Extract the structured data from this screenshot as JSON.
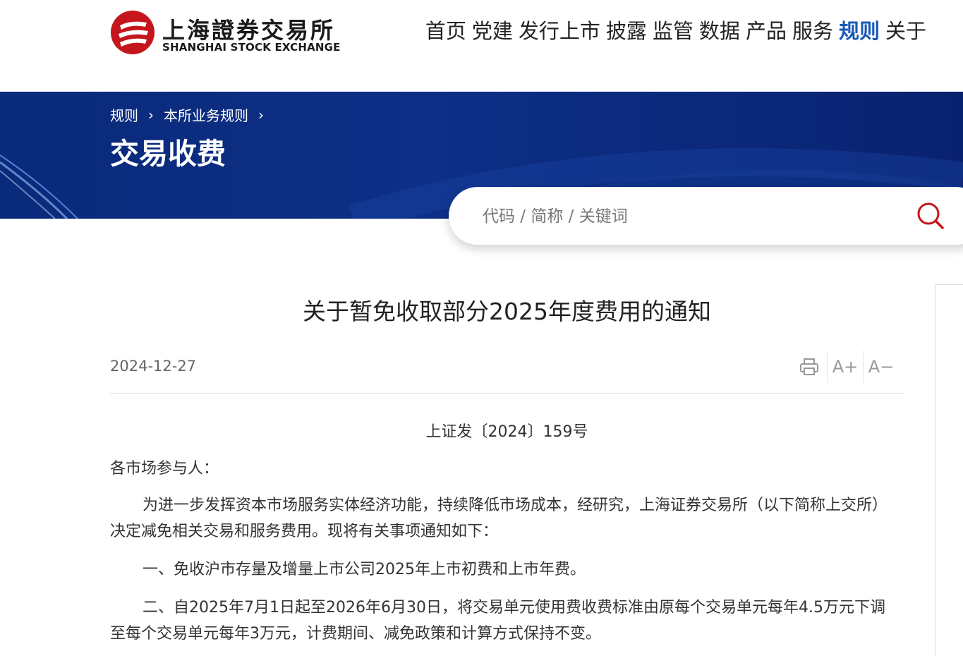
{
  "header": {
    "logo_cn": "上海證券交易所",
    "logo_en": "SHANGHAI STOCK EXCHANGE",
    "nav": [
      "首页",
      "党建",
      "发行上市",
      "披露",
      "监管",
      "数据",
      "产品",
      "服务",
      "规则",
      "关于"
    ],
    "active_nav": "规则"
  },
  "banner": {
    "breadcrumb": [
      "规则",
      "本所业务规则"
    ],
    "title": "交易收费"
  },
  "search": {
    "placeholder": "代码 / 简称 / 关键词"
  },
  "article": {
    "title": "关于暂免收取部分2025年度费用的通知",
    "date": "2024-12-27",
    "tools": {
      "print_icon": "print-icon",
      "increase_font": "A+",
      "decrease_font": "A−"
    },
    "doc_number": "上证发〔2024〕159号",
    "salutation": "各市场参与人：",
    "paragraphs": [
      "为进一步发挥资本市场服务实体经济功能，持续降低市场成本，经研究，上海证券交易所（以下简称上交所）决定减免相关交易和服务费用。现将有关事项通知如下：",
      "一、免收沪市存量及增量上市公司2025年上市初费和上市年费。",
      "二、自2025年7月1日起至2026年6月30日，将交易单元使用费收费标准由原每个交易单元每年4.5万元下调至每个交易单元每年3万元，计费期间、减免政策和计算方式保持不变。"
    ]
  },
  "colors": {
    "accent": "#1859b7",
    "banner": "#0d2f86",
    "logo_red": "#c4161c"
  }
}
